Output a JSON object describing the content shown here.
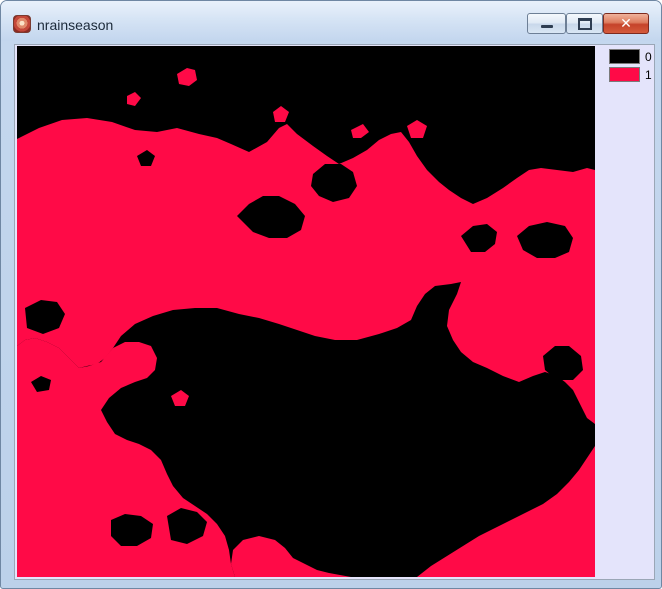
{
  "window": {
    "title": "nrainseason",
    "icon": "raster-map-icon",
    "buttons": {
      "minimize": "minimize",
      "maximize": "maximize",
      "close": "close"
    }
  },
  "map": {
    "background_color": "#000000",
    "foreground_color": "#ff0a47"
  },
  "legend": {
    "items": [
      {
        "label": "0",
        "color": "#000000"
      },
      {
        "label": "1",
        "color": "#ff0a47"
      }
    ]
  }
}
